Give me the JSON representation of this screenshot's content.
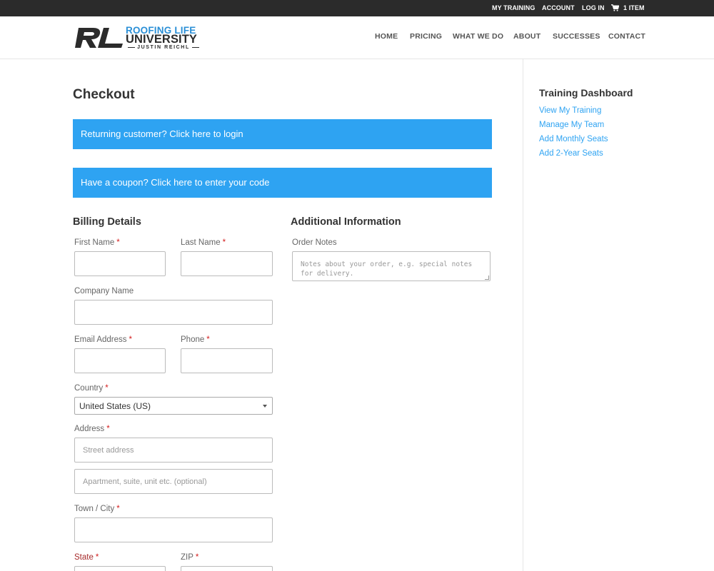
{
  "topbar": {
    "links": [
      "MY TRAINING",
      "ACCOUNT",
      "LOG IN"
    ],
    "cart_label": "1 ITEM"
  },
  "header": {
    "logo": {
      "monogram": "RL",
      "line1": "ROOFING LIFE",
      "line2": "UNIVERSITY",
      "line3": "JUSTIN REICHL"
    },
    "nav": [
      "HOME",
      "PRICING",
      "WHAT WE DO",
      "ABOUT",
      "SUCCESSES",
      "CONTACT"
    ]
  },
  "main": {
    "title": "Checkout",
    "notices": {
      "login": "Returning customer? Click here to login",
      "coupon": "Have a coupon? Click here to enter your code"
    },
    "billing": {
      "title": "Billing Details",
      "required_mark": "*",
      "fields": {
        "first_name": "First Name",
        "last_name": "Last Name",
        "company": "Company Name",
        "email": "Email Address",
        "phone": "Phone",
        "country": "Country",
        "country_value": "United States (US)",
        "address": "Address",
        "street_placeholder": "Street address",
        "apartment_placeholder": "Apartment, suite, unit etc. (optional)",
        "city": "Town / City",
        "state": "State",
        "zip": "ZIP"
      }
    },
    "additional": {
      "title": "Additional Information",
      "order_notes_label": "Order Notes",
      "order_notes_placeholder": "Notes about your order, e.g. special notes for delivery."
    }
  },
  "sidebar": {
    "title": "Training Dashboard",
    "links": [
      "View My Training",
      "Manage My Team",
      "Add Monthly Seats",
      "Add 2-Year Seats"
    ]
  },
  "colors": {
    "accent": "#2ea3f2",
    "topbar": "#2b2b2b",
    "required": "#d31d1d",
    "logo_blue": "#2a8fd6"
  }
}
